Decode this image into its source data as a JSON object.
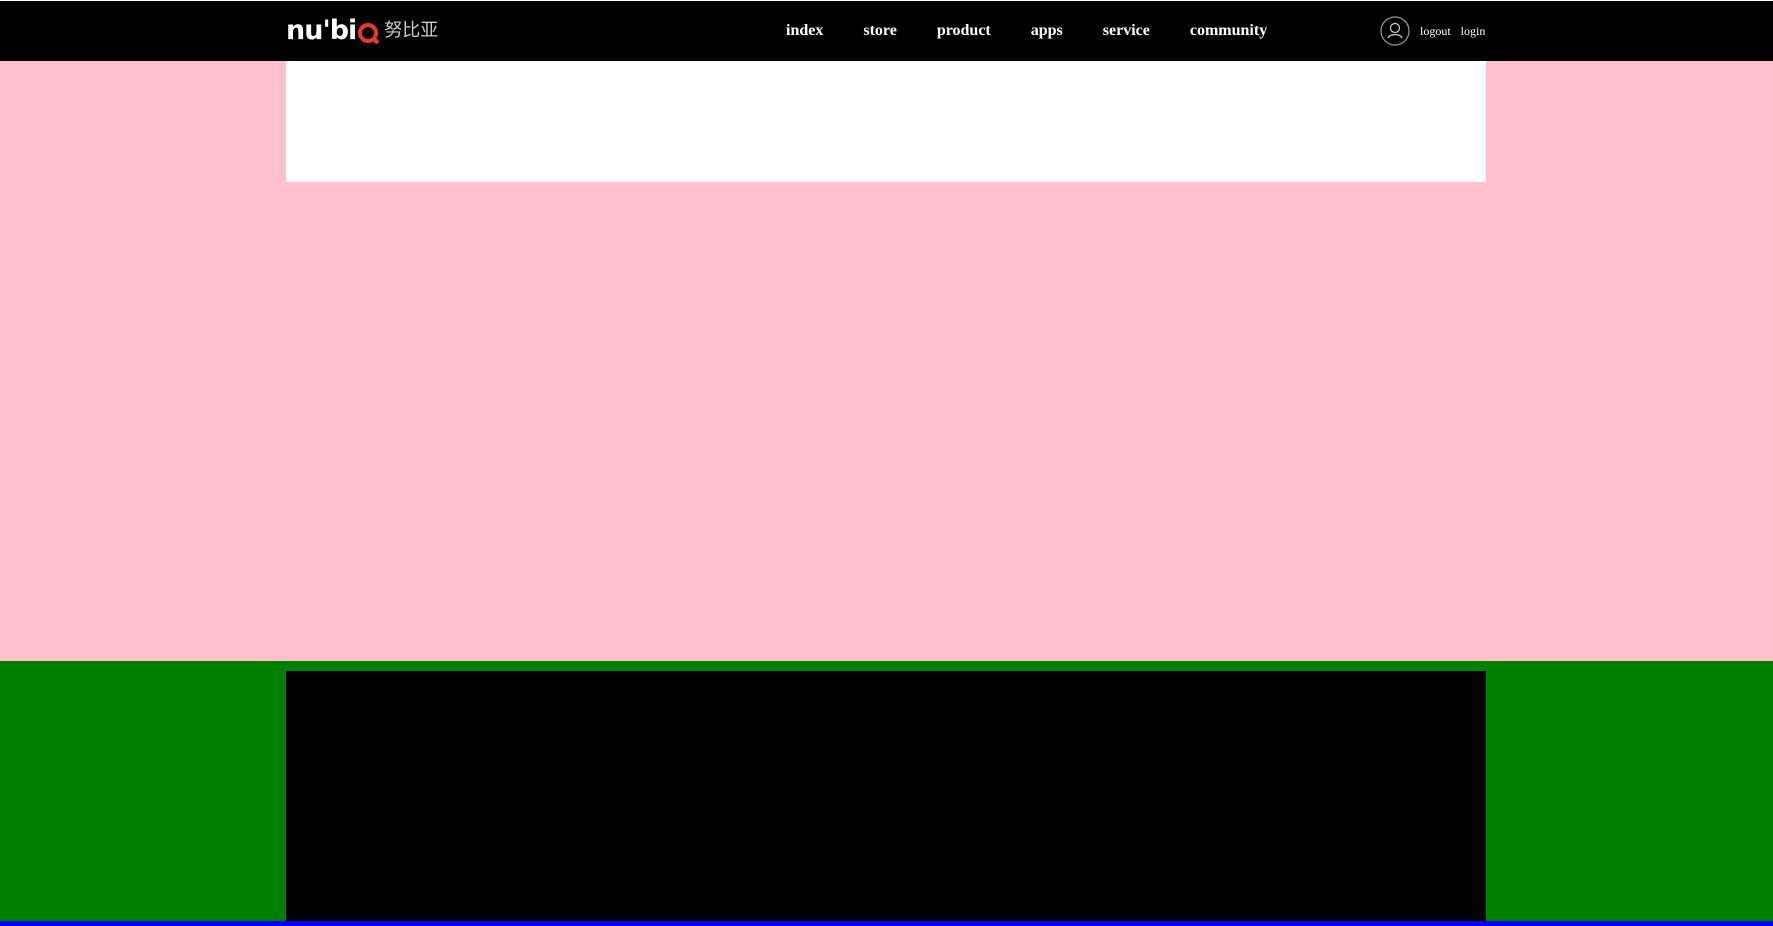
{
  "header": {
    "logo": {
      "wordmark": "nubia",
      "wordmark_display": "nu'bi",
      "chinese_name": "努比亚",
      "accent_color": "#e8392b"
    },
    "nav": [
      {
        "label": "index"
      },
      {
        "label": "store"
      },
      {
        "label": "product"
      },
      {
        "label": "apps"
      },
      {
        "label": "service"
      },
      {
        "label": "community"
      }
    ],
    "account": {
      "icon": "user-avatar-icon",
      "logout_label": "logout",
      "login_label": "login"
    },
    "background": "#000000"
  },
  "sections": {
    "pink_background": "#ffc0cb",
    "banner_background": "#ffffff",
    "green_background": "#008000",
    "panel_background": "#000000",
    "bottom_strip": "#0000ff"
  }
}
